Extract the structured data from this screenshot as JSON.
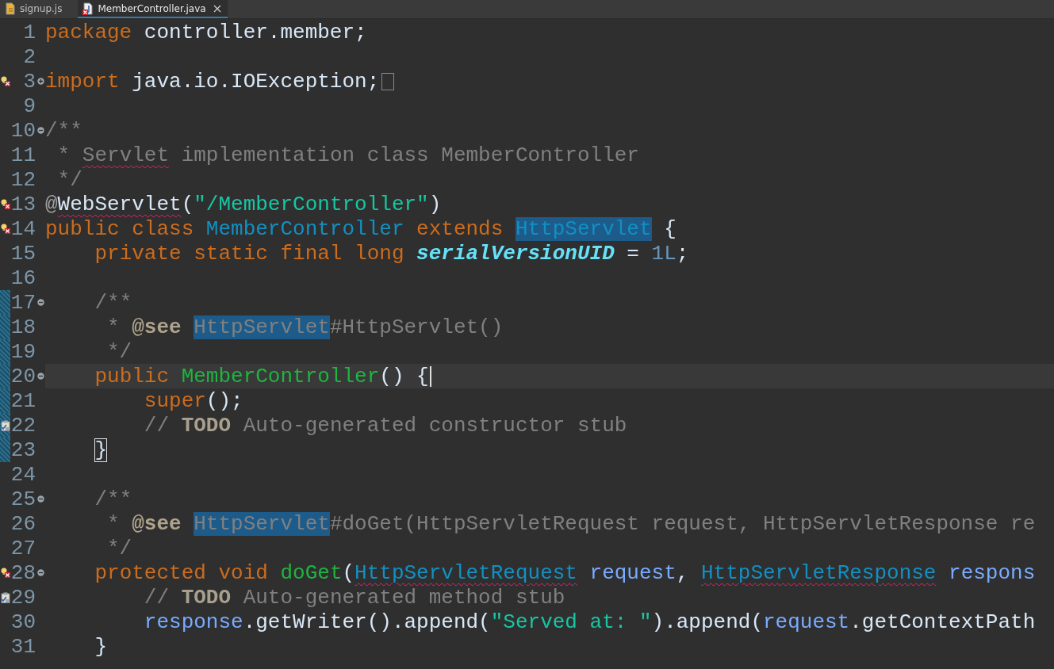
{
  "tabs": [
    {
      "label": "signup.js",
      "kind": "js",
      "selected": false,
      "error": false
    },
    {
      "label": "MemberController.java",
      "kind": "java",
      "selected": true,
      "error": true
    }
  ],
  "lines": [
    {
      "number": "1",
      "error": false,
      "task": false,
      "current": false,
      "changed": false,
      "tokens": [
        {
          "t": "package ",
          "kind": "keyword"
        },
        {
          "t": "controller.member;",
          "kind": "plain"
        }
      ]
    },
    {
      "number": "2",
      "error": false,
      "task": false,
      "current": false,
      "changed": false
    },
    {
      "number": "3",
      "error": true,
      "task": false,
      "current": false,
      "changed": false,
      "fold_expanded": false,
      "folded": true,
      "tokens": [
        {
          "t": "import ",
          "kind": "keyword"
        },
        {
          "t": "java.io.IOException;",
          "kind": "plain"
        }
      ]
    },
    {
      "number": "9",
      "error": false,
      "task": false,
      "current": false,
      "changed": false
    },
    {
      "number": "10",
      "error": false,
      "task": false,
      "current": false,
      "changed": false,
      "fold_expanded": true,
      "tokens": [
        {
          "t": "/**",
          "kind": "comment"
        }
      ]
    },
    {
      "number": "11",
      "error": false,
      "task": false,
      "current": false,
      "changed": false,
      "tokens": [
        {
          "t": " * ",
          "kind": "comment"
        },
        {
          "t": "Servlet",
          "kind": "comment",
          "sq": true
        },
        {
          "t": " implementation class MemberController",
          "kind": "comment"
        }
      ]
    },
    {
      "number": "12",
      "error": false,
      "task": false,
      "current": false,
      "changed": false,
      "tokens": [
        {
          "t": " */",
          "kind": "comment"
        }
      ]
    },
    {
      "number": "13",
      "error": true,
      "task": false,
      "current": false,
      "changed": false,
      "tokens": [
        {
          "t": "@",
          "kind": "annotation"
        },
        {
          "t": "WebServlet",
          "kind": "plain",
          "sq": true
        },
        {
          "t": "(",
          "kind": "plain"
        },
        {
          "t": "\"/MemberController\"",
          "kind": "string"
        },
        {
          "t": ")",
          "kind": "plain"
        }
      ]
    },
    {
      "number": "14",
      "error": true,
      "task": false,
      "current": false,
      "changed": false,
      "tokens": [
        {
          "t": "public class ",
          "kind": "keyword"
        },
        {
          "t": "MemberController",
          "kind": "type"
        },
        {
          "t": " extends ",
          "kind": "keyword"
        },
        {
          "t": "HttpServlet",
          "kind": "type",
          "hl": true
        },
        {
          "t": " {",
          "kind": "plain"
        }
      ]
    },
    {
      "number": "15",
      "error": false,
      "task": false,
      "current": false,
      "changed": false,
      "tokens": [
        {
          "t": "    private static final long ",
          "kind": "keyword"
        },
        {
          "t": "serialVersionUID",
          "kind": "field"
        },
        {
          "t": " = ",
          "kind": "plain"
        },
        {
          "t": "1L",
          "kind": "number"
        },
        {
          "t": ";",
          "kind": "plain"
        }
      ]
    },
    {
      "number": "16",
      "error": false,
      "task": false,
      "current": false,
      "changed": false
    },
    {
      "number": "17",
      "error": false,
      "task": false,
      "current": false,
      "changed": true,
      "fold_expanded": true,
      "tokens": [
        {
          "t": "    /**",
          "kind": "comment"
        }
      ]
    },
    {
      "number": "18",
      "error": false,
      "task": false,
      "current": false,
      "changed": true,
      "tokens": [
        {
          "t": "     * ",
          "kind": "comment"
        },
        {
          "t": "@see ",
          "kind": "doctag"
        },
        {
          "t": "HttpServlet",
          "kind": "comment",
          "hl": true
        },
        {
          "t": "#HttpServlet()",
          "kind": "comment"
        }
      ]
    },
    {
      "number": "19",
      "error": false,
      "task": false,
      "current": false,
      "changed": true,
      "tokens": [
        {
          "t": "     */",
          "kind": "comment"
        }
      ]
    },
    {
      "number": "20",
      "error": false,
      "task": false,
      "current": true,
      "changed": true,
      "fold_expanded": true,
      "tokens": [
        {
          "t": "    public ",
          "kind": "keyword"
        },
        {
          "t": "MemberController",
          "kind": "method"
        },
        {
          "t": "() {",
          "kind": "plain"
        }
      ]
    },
    {
      "number": "21",
      "error": false,
      "task": false,
      "current": false,
      "changed": true,
      "tokens": [
        {
          "t": "        super",
          "kind": "keyword"
        },
        {
          "t": "();",
          "kind": "plain"
        }
      ]
    },
    {
      "number": "22",
      "error": false,
      "task": true,
      "current": false,
      "changed": true,
      "tokens": [
        {
          "t": "        // ",
          "kind": "comment"
        },
        {
          "t": "TODO",
          "kind": "todo"
        },
        {
          "t": " Auto-generated constructor stub",
          "kind": "comment"
        }
      ]
    },
    {
      "number": "23",
      "error": false,
      "task": false,
      "current": false,
      "changed": true,
      "tokens": [
        {
          "t": "    }",
          "kind": "plain",
          "match": true
        }
      ]
    },
    {
      "number": "24",
      "error": false,
      "task": false,
      "current": false,
      "changed": false
    },
    {
      "number": "25",
      "error": false,
      "task": false,
      "current": false,
      "changed": false,
      "fold_expanded": true,
      "tokens": [
        {
          "t": "    /**",
          "kind": "comment"
        }
      ]
    },
    {
      "number": "26",
      "error": false,
      "task": false,
      "current": false,
      "changed": false,
      "tokens": [
        {
          "t": "     * ",
          "kind": "comment"
        },
        {
          "t": "@see ",
          "kind": "doctag"
        },
        {
          "t": "HttpServlet",
          "kind": "comment",
          "hl": true
        },
        {
          "t": "#doGet(HttpServletRequest request, HttpServletResponse re",
          "kind": "comment"
        }
      ]
    },
    {
      "number": "27",
      "error": false,
      "task": false,
      "current": false,
      "changed": false,
      "tokens": [
        {
          "t": "     */",
          "kind": "comment"
        }
      ]
    },
    {
      "number": "28",
      "error": true,
      "task": false,
      "current": false,
      "changed": false,
      "fold_expanded": true,
      "tokens": [
        {
          "t": "    protected void ",
          "kind": "keyword"
        },
        {
          "t": "doGet",
          "kind": "method"
        },
        {
          "t": "(",
          "kind": "plain"
        },
        {
          "t": "HttpServletRequest",
          "kind": "type",
          "sq": true
        },
        {
          "t": " request",
          "kind": "param"
        },
        {
          "t": ", ",
          "kind": "plain"
        },
        {
          "t": "HttpServletResponse",
          "kind": "type",
          "sq": true
        },
        {
          "t": " respons",
          "kind": "param"
        }
      ]
    },
    {
      "number": "29",
      "error": false,
      "task": true,
      "current": false,
      "changed": false,
      "tokens": [
        {
          "t": "        // ",
          "kind": "comment"
        },
        {
          "t": "TODO",
          "kind": "todo"
        },
        {
          "t": " Auto-generated method stub",
          "kind": "comment"
        }
      ]
    },
    {
      "number": "30",
      "error": false,
      "task": false,
      "current": false,
      "changed": false,
      "tokens": [
        {
          "t": "        response",
          "kind": "param"
        },
        {
          "t": ".getWriter().append(",
          "kind": "plain"
        },
        {
          "t": "\"Served at: \"",
          "kind": "string"
        },
        {
          "t": ").append(",
          "kind": "plain"
        },
        {
          "t": "request",
          "kind": "param"
        },
        {
          "t": ".getContextPath",
          "kind": "plain"
        }
      ]
    },
    {
      "number": "31",
      "error": false,
      "task": false,
      "current": false,
      "changed": false,
      "tokens": [
        {
          "t": "    }",
          "kind": "plain"
        }
      ]
    }
  ]
}
